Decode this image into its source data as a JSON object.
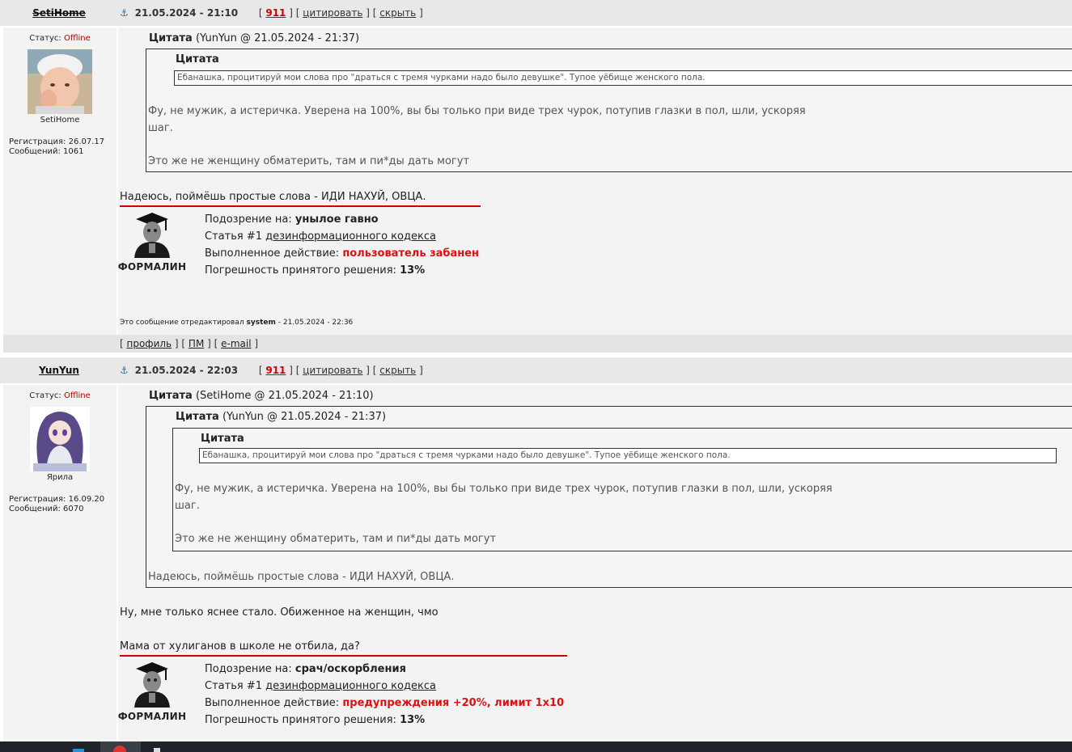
{
  "posts": [
    {
      "author": "SetiHome",
      "date": "21.05.2024 - 21:10",
      "reply_count": "911",
      "quote_label": "цитировать",
      "hide_label": "скрыть",
      "status_label": "Статус:",
      "status_value": "Offline",
      "avatar_name": "SetiHome",
      "registration": "Регистрация: 26.07.17",
      "messages": "Сообщений: 1061",
      "quote_outer": {
        "title": "Цитата",
        "source": "(YunYun @ 21.05.2024 - 21:37)",
        "inner_title": "Цитата",
        "inner_text": "Ебанашка, процитируй мои слова про \"драться с тремя чурками надо было девушке\". Тупое уёбище женского пола.",
        "line1": "Фу, не мужик, а истеричка. Уверена на 100%, вы бы только при виде трех чурок, потупив глазки в пол, шли, ускоряя",
        "line2": "шаг.",
        "line3": "Это же не женщину обматерить, там и пи*ды дать могут"
      },
      "body_text": "Надеюсь, поймёшь простые слова - ИДИ НАХУЙ, ОВЦА.",
      "moderation": {
        "bot_name": "ФОРМАЛИН",
        "suspicion_label": "Подозрение на:",
        "suspicion_value": "унылое гавно",
        "article_prefix": "Статья #1",
        "article_link": "дезинформационного кодекса",
        "action_label": "Выполненное действие:",
        "action_value": "пользователь забанен",
        "error_label": "Погрешность принятого решения:",
        "error_value": "13%"
      },
      "edited_prefix": "Это сообщение отредактировал",
      "edited_by": "system",
      "edited_date": "- 21.05.2024 - 22:36",
      "footer": {
        "profile": "профиль",
        "pm": "ПМ",
        "email": "e-mail"
      }
    },
    {
      "author": "YunYun",
      "date": "21.05.2024 - 22:03",
      "reply_count": "911",
      "quote_label": "цитировать",
      "hide_label": "скрыть",
      "status_label": "Статус:",
      "status_value": "Offline",
      "avatar_name": "Ярила",
      "registration": "Регистрация: 16.09.20",
      "messages": "Сообщений: 6070",
      "quote_outer": {
        "title": "Цитата",
        "source": "(SetiHome @ 21.05.2024 - 21:10)",
        "mid_title": "Цитата",
        "mid_source": "(YunYun @ 21.05.2024 - 21:37)",
        "inner_title": "Цитата",
        "inner_text": "Ебанашка, процитируй мои слова про \"драться с тремя чурками надо было девушке\". Тупое уёбище женского пола.",
        "line1": "Фу, не мужик, а истеричка. Уверена на 100%, вы бы только при виде трех чурок, потупив глазки в пол, шли, ускоряя",
        "line2": "шаг.",
        "line3": "Это же не женщину обматерить, там и пи*ды дать могут",
        "outer_line": "Надеюсь, поймёшь простые слова - ИДИ НАХУЙ, ОВЦА."
      },
      "body_text1": "Ну, мне только яснее стало. Обиженное на женщин, чмо",
      "body_text2": "Мама от хулиганов в школе не отбила, да?",
      "moderation": {
        "bot_name": "ФОРМАЛИН",
        "suspicion_label": "Подозрение на:",
        "suspicion_value": "срач/оскорбления",
        "article_prefix": "Статья #1",
        "article_link": "дезинформационного кодекса",
        "action_label": "Выполненное действие:",
        "action_value": "предупреждения +20%, лимит 1x10",
        "error_label": "Погрешность принятого решения:",
        "error_value": "13%"
      }
    }
  ],
  "icons": {
    "anchor": "anchor-icon"
  },
  "colors": {
    "offline": "#b40000",
    "accent_red": "#cc0000",
    "header_bg": "#e8e8e8"
  }
}
